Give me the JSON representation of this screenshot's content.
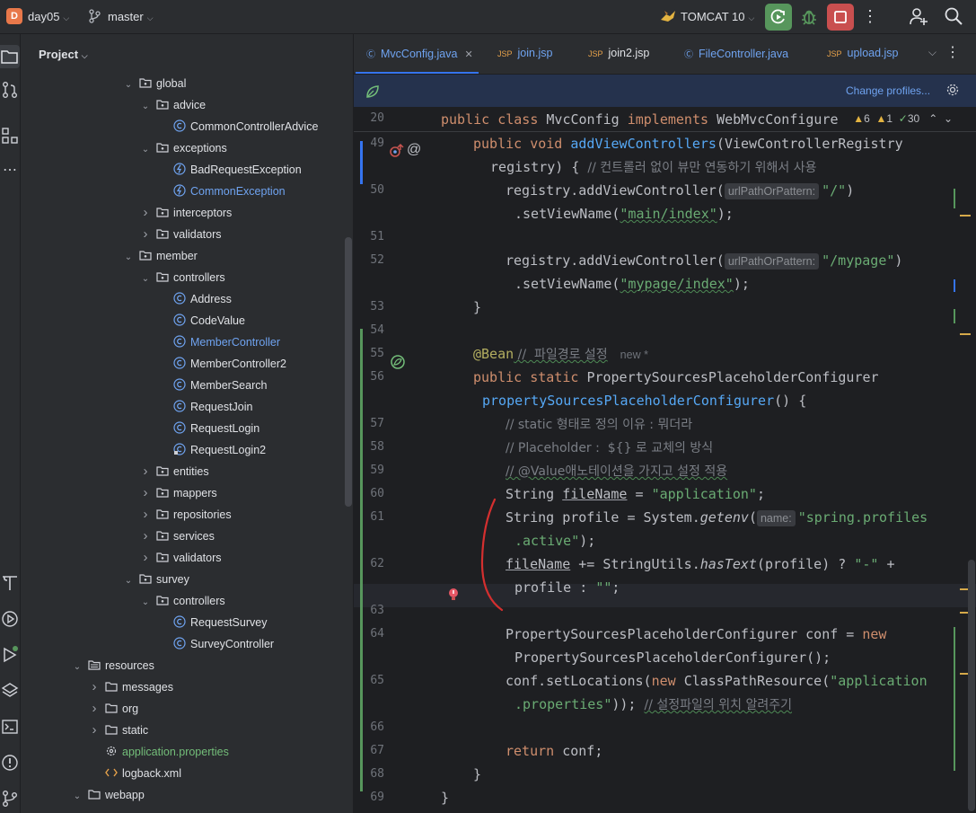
{
  "titlebar": {
    "project_badge": "D",
    "project_name": "day05",
    "branch": "master",
    "run_config": "TOMCAT 10"
  },
  "project_panel": {
    "title": "Project",
    "tree": [
      {
        "label": "global",
        "kind": "package",
        "depth": 0,
        "expanded": true
      },
      {
        "label": "advice",
        "kind": "package",
        "depth": 1,
        "expanded": true
      },
      {
        "label": "CommonControllerAdvice",
        "kind": "class",
        "depth": 2
      },
      {
        "label": "exceptions",
        "kind": "package",
        "depth": 1,
        "expanded": true
      },
      {
        "label": "BadRequestException",
        "kind": "exception",
        "depth": 2
      },
      {
        "label": "CommonException",
        "kind": "exception",
        "depth": 2,
        "color": "blue"
      },
      {
        "label": "interceptors",
        "kind": "package",
        "depth": 1,
        "expanded": false
      },
      {
        "label": "validators",
        "kind": "package",
        "depth": 1,
        "expanded": false
      },
      {
        "label": "member",
        "kind": "package",
        "depth": 0,
        "expanded": true
      },
      {
        "label": "controllers",
        "kind": "package",
        "depth": 1,
        "expanded": true
      },
      {
        "label": "Address",
        "kind": "class",
        "depth": 2
      },
      {
        "label": "CodeValue",
        "kind": "class",
        "depth": 2
      },
      {
        "label": "MemberController",
        "kind": "class",
        "depth": 2,
        "color": "blue"
      },
      {
        "label": "MemberController2",
        "kind": "class",
        "depth": 2
      },
      {
        "label": "MemberSearch",
        "kind": "class",
        "depth": 2
      },
      {
        "label": "RequestJoin",
        "kind": "class",
        "depth": 2
      },
      {
        "label": "RequestLogin",
        "kind": "class",
        "depth": 2
      },
      {
        "label": "RequestLogin2",
        "kind": "class-locked",
        "depth": 2
      },
      {
        "label": "entities",
        "kind": "package",
        "depth": 1,
        "expanded": false
      },
      {
        "label": "mappers",
        "kind": "package",
        "depth": 1,
        "expanded": false
      },
      {
        "label": "repositories",
        "kind": "package",
        "depth": 1,
        "expanded": false
      },
      {
        "label": "services",
        "kind": "package",
        "depth": 1,
        "expanded": false
      },
      {
        "label": "validators",
        "kind": "package",
        "depth": 1,
        "expanded": false
      },
      {
        "label": "survey",
        "kind": "package",
        "depth": 0,
        "expanded": true
      },
      {
        "label": "controllers",
        "kind": "package",
        "depth": 1,
        "expanded": true
      },
      {
        "label": "RequestSurvey",
        "kind": "class",
        "depth": 2
      },
      {
        "label": "SurveyController",
        "kind": "class",
        "depth": 2
      },
      {
        "label": "resources",
        "kind": "resources",
        "depth": -3,
        "expanded": true
      },
      {
        "label": "messages",
        "kind": "folder",
        "depth": -2,
        "expanded": false
      },
      {
        "label": "org",
        "kind": "folder",
        "depth": -2,
        "expanded": false
      },
      {
        "label": "static",
        "kind": "folder",
        "depth": -2,
        "expanded": false
      },
      {
        "label": "application.properties",
        "kind": "properties",
        "depth": -2,
        "color": "green"
      },
      {
        "label": "logback.xml",
        "kind": "xml",
        "depth": -2
      },
      {
        "label": "webapp",
        "kind": "folder",
        "depth": -3,
        "expanded": true
      }
    ]
  },
  "editor": {
    "tabs": [
      {
        "label": "MvcConfig.java",
        "icon": "java-class-icon",
        "active": true
      },
      {
        "label": "join.jsp",
        "icon": "jsp-icon"
      },
      {
        "label": "join2.jsp",
        "icon": "jsp-icon"
      },
      {
        "label": "FileController.java",
        "icon": "java-class-icon"
      },
      {
        "label": "upload.jsp",
        "icon": "jsp-icon"
      }
    ],
    "banner": {
      "link": "Change profiles..."
    },
    "sticky": {
      "line": "20",
      "text_kw1": "public class ",
      "text_name": "MvcConfig ",
      "text_kw2": "implements ",
      "text_iface": "WebMvcConfigure"
    },
    "inspections": {
      "warnings": "6",
      "weak_warnings": "1",
      "ok": "30"
    },
    "hints": {
      "url_param": "urlPathOrPattern:",
      "name_param": "name:",
      "new_marker": "new *"
    },
    "line_numbers": [
      "49",
      "50",
      "51",
      "52",
      "53",
      "54",
      "55",
      "56",
      "57",
      "58",
      "59",
      "60",
      "61",
      "62",
      "63",
      "64",
      "65",
      "66",
      "67",
      "68",
      "69"
    ],
    "code": {
      "l49_a": "public void ",
      "l49_fn": "addViewControllers",
      "l49_b": "(ViewControllerRegistry",
      "l49_c": " registry) { ",
      "l49_cm": "// 컨트롤러 없이 뷰만 연동하기 위해서 사용",
      "l50_a": "registry.addViewController(",
      "l50_str": "\"/\"",
      "l50_b": ")",
      "l50c_a": ".setViewName(",
      "l50c_str": "\"main/index\"",
      "l50c_b": ");",
      "l52_a": "registry.addViewController(",
      "l52_str": "\"/mypage\"",
      "l52_b": ")",
      "l52c_a": ".setViewName(",
      "l52c_str": "\"mypage/index\"",
      "l52c_b": ");",
      "l53": "}",
      "l55_ann": "@Bean",
      "l55_cm": " //  파일경로 설정",
      "l56_kw": "public static ",
      "l56_b": "PropertySourcesPlaceholderConfigurer",
      "l56c_fn": "propertySourcesPlaceholderConfigurer",
      "l56c_b": "() {",
      "l57": "// static 형태로 정의 이유 : 뭐더라",
      "l58": "// Placeholder :  ${} 로 교체의 방식",
      "l59": "// @Value애노테이션을 가지고 설정 적용",
      "l60_a": "String ",
      "l60_var": "fileName",
      "l60_b": " = ",
      "l60_str": "\"application\"",
      "l60_c": ";",
      "l61_a": "String profile = System.",
      "l61_m": "getenv",
      "l61_b": "(",
      "l61_str": "\"spring.profiles",
      "l61c_str": ".active\"",
      "l61c_b": ");",
      "l62_var": "fileName",
      "l62_a": " += StringUtils.",
      "l62_m": "hasText",
      "l62_b": "(profile) ? ",
      "l62_str": "\"-\"",
      "l62_c": " + ",
      "l62c_a": "profile : ",
      "l62c_str": "\"\"",
      "l62c_b": ";",
      "l64_a": "PropertySourcesPlaceholderConfigurer conf = ",
      "l64_kw": "new",
      "l64c": "PropertySourcesPlaceholderConfigurer();",
      "l65_a": "conf.setLocations(",
      "l65_kw": "new ",
      "l65_b": "ClassPathResource(",
      "l65_str": "\"application",
      "l65c_str": ".properties\"",
      "l65c_b": ")); ",
      "l65c_cm": "// 설정파일의 위치 알려주기",
      "l67_kw": "return ",
      "l67_b": "conf;",
      "l68": "}",
      "l69": "}"
    }
  }
}
